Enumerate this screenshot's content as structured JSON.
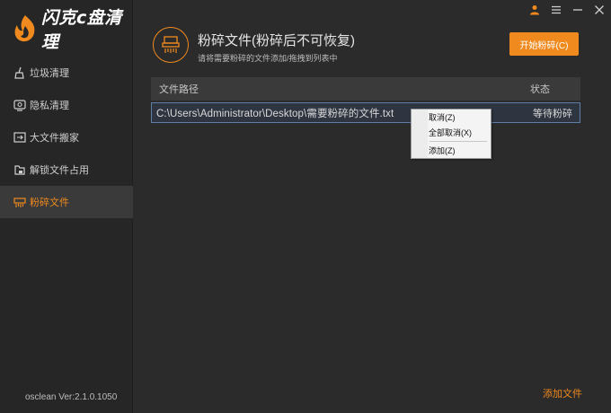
{
  "app": {
    "logo_text": "闪克c盘清理",
    "version": "osclean Ver:2.1.0.1050"
  },
  "sidebar": {
    "items": [
      {
        "label": "垃圾清理",
        "icon": "broom-icon"
      },
      {
        "label": "隐私清理",
        "icon": "privacy-icon"
      },
      {
        "label": "大文件搬家",
        "icon": "move-folder-icon"
      },
      {
        "label": "解锁文件占用",
        "icon": "unlock-icon"
      },
      {
        "label": "粉碎文件",
        "icon": "shredder-icon",
        "active": true
      }
    ]
  },
  "header": {
    "title": "粉碎文件(粉碎后不可恢复)",
    "subtitle": "请将需要粉碎的文件添加/拖拽到列表中",
    "start_button": "开始粉碎(C)"
  },
  "table": {
    "columns": [
      "文件路径",
      "状态"
    ],
    "rows": [
      {
        "path": "C:\\Users\\Administrator\\Desktop\\需要粉碎的文件.txt",
        "status": "等待粉碎"
      }
    ]
  },
  "context_menu": {
    "items": [
      "取消(Z)",
      "全部取消(X)",
      "添加(Z)"
    ]
  },
  "footer": {
    "add_file": "添加文件"
  },
  "colors": {
    "accent": "#f08a1e",
    "background": "#2b2b2b",
    "sidebar": "#262626"
  }
}
